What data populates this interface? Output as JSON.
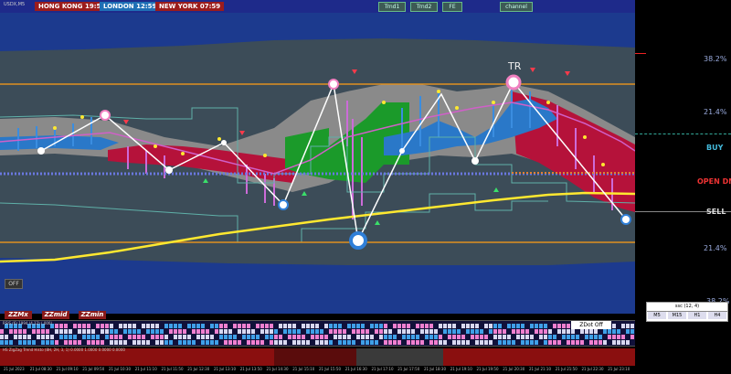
{
  "symbol": "USDX,M5",
  "clocks": [
    {
      "city": "HONG KONG",
      "time": "19:59",
      "color": "#9b1c1c"
    },
    {
      "city": "LONDON",
      "time": "12:59",
      "color": "#1f6fb5"
    },
    {
      "city": "NEW YORK",
      "time": "07:59",
      "color": "#9b1c1c"
    }
  ],
  "toolbar_buttons": [
    "Trnd1",
    "Trnd2",
    "FE",
    "channel"
  ],
  "chart_labels": {
    "tr": "TR"
  },
  "axis": {
    "levels": [
      {
        "label": "38.2%",
        "color": "#9ad"
      },
      {
        "label": "21.4%",
        "color": "#9ad"
      },
      {
        "label": "BUY",
        "color": "#4bd"
      },
      {
        "label": "OPEN DN",
        "color": "#e33"
      },
      {
        "label": "SELL",
        "color": "#ddd"
      },
      {
        "label": "21.4%",
        "color": "#9ad"
      },
      {
        "label": "38.2%",
        "color": "#9ad"
      }
    ]
  },
  "buttons": {
    "off": "OFF",
    "zzmx": "ZZMx",
    "zzmid": "ZZmid",
    "zzmin": "ZZmin",
    "zdot": "ZDot Off"
  },
  "timeframes": {
    "header": "ssc (12, 4)",
    "items": [
      "M5",
      "M15",
      "H1",
      "H4"
    ]
  },
  "panes": {
    "pane1_title": "RSIS (6) 1994 (4,12) (,000)",
    "pane2_title": "HS ZigZag Trend Histo (8H, 2H, 3, 1) 0.0000 1.0000 0.0000 0.0000"
  },
  "time_labels": [
    "21 Jul 2023",
    "21 Jul 08:30",
    "21 Jul 09:10",
    "21 Jul 09:50",
    "21 Jul 10:30",
    "21 Jul 11:10",
    "21 Jul 11:50",
    "21 Jul 12:30",
    "21 Jul 13:10",
    "21 Jul 13:50",
    "21 Jul 14:30",
    "21 Jul 15:10",
    "21 Jul 15:50",
    "21 Jul 16:30",
    "21 Jul 17:10",
    "21 Jul 17:50",
    "21 Jul 18:30",
    "21 Jul 19:10",
    "21 Jul 19:50",
    "21 Jul 20:30",
    "21 Jul 21:10",
    "21 Jul 21:50",
    "21 Jul 22:30",
    "21 Jul 23:10"
  ]
}
